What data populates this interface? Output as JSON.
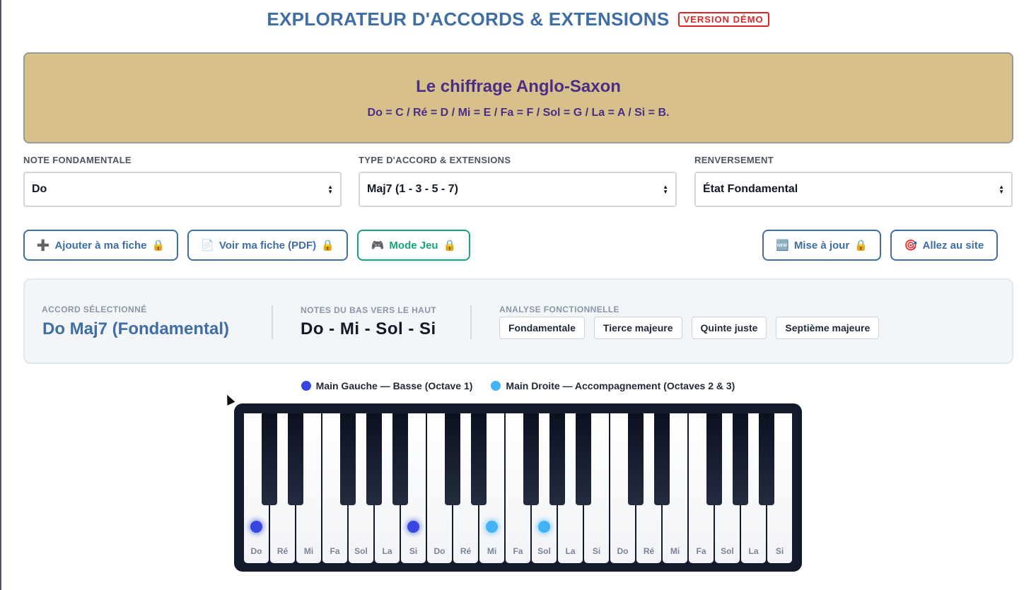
{
  "header": {
    "title": "EXPLORATEUR D'ACCORDS & EXTENSIONS",
    "badge": "VERSION DÉMO"
  },
  "banner": {
    "title": "Le chiffrage Anglo-Saxon",
    "subtitle": "Do = C / Ré = D / Mi = E / Fa = F / Sol = G / La = A / Si = B."
  },
  "selects": {
    "root": {
      "label": "NOTE FONDAMENTALE",
      "value": "Do"
    },
    "type": {
      "label": "TYPE D'ACCORD & EXTENSIONS",
      "value": "Maj7 (1 - 3 - 5 - 7)"
    },
    "inversion": {
      "label": "RENVERSEMENT",
      "value": "État Fondamental"
    }
  },
  "buttons": {
    "add": {
      "icon": "➕",
      "label": "Ajouter à ma fiche",
      "lock": "🔒"
    },
    "pdf": {
      "icon": "📄",
      "label": "Voir ma fiche (PDF)",
      "lock": "🔒"
    },
    "game": {
      "icon": "🎮",
      "label": "Mode Jeu",
      "lock": "🔒"
    },
    "update": {
      "icon": "🆕",
      "label": "Mise à jour",
      "lock": "🔒"
    },
    "site": {
      "icon": "🎯",
      "label": "Allez au site"
    }
  },
  "summary": {
    "selected_label": "ACCORD SÉLECTIONNÉ",
    "selected_value": "Do Maj7 (Fondamental)",
    "notes_label": "NOTES DU BAS VERS LE HAUT",
    "notes_value": "Do - Mi - Sol - Si",
    "analysis_label": "ANALYSE FONCTIONNELLE",
    "analysis_tags": [
      "Fondamentale",
      "Tierce majeure",
      "Quinte juste",
      "Septième majeure"
    ]
  },
  "legend": {
    "left_hand": "Main Gauche — Basse (Octave 1)",
    "right_hand": "Main Droite — Accompagnement (Octaves 2 & 3)",
    "left_color": "#3547e0",
    "right_color": "#42b4f5"
  },
  "piano": {
    "white_keys": [
      "Do",
      "Ré",
      "Mi",
      "Fa",
      "Sol",
      "La",
      "Si",
      "Do",
      "Ré",
      "Mi",
      "Fa",
      "Sol",
      "La",
      "Si",
      "Do",
      "Ré",
      "Mi",
      "Fa",
      "Sol",
      "La",
      "Si"
    ],
    "highlighted": [
      {
        "key": 0,
        "hand": "left"
      },
      {
        "key": 6,
        "hand": "left"
      },
      {
        "key": 9,
        "hand": "right"
      },
      {
        "key": 11,
        "hand": "right"
      }
    ]
  }
}
